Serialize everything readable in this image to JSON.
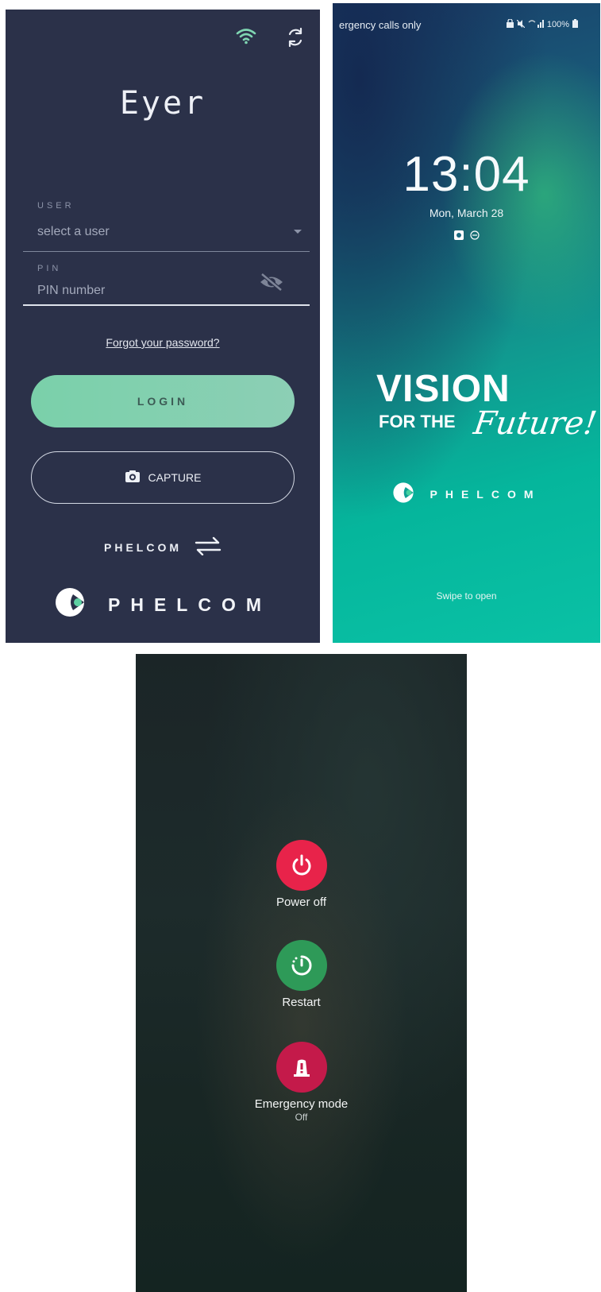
{
  "login": {
    "title": "Eyer",
    "user_label": "USER",
    "user_placeholder": "select a user",
    "pin_label": "PIN",
    "pin_placeholder": "PIN number",
    "forgot_link": "Forgot your password?",
    "login_button": "LOGIN",
    "capture_button": "CAPTURE",
    "switch_brand": "PHELCOM",
    "brand": "PHELCOM",
    "icons": [
      "wifi-icon",
      "sync-icon",
      "eye-off-icon",
      "camera-icon",
      "swap-icon",
      "phelcom-logo-icon"
    ],
    "colors": {
      "background": "#2b3149",
      "login_button": "#7fd0ae"
    }
  },
  "lockscreen": {
    "status_left": "ergency calls only",
    "status_right": "100%",
    "time": "13:04",
    "date": "Mon, March 28",
    "slogan_line1": "VISION",
    "slogan_line2a": "FOR THE",
    "slogan_line2b": "Future!",
    "brand": "PHELCOM",
    "swipe_hint": "Swipe to open"
  },
  "power_menu": {
    "items": [
      {
        "label": "Power off",
        "color": "#e8234a"
      },
      {
        "label": "Restart",
        "color": "#2e9a58"
      },
      {
        "label": "Emergency mode",
        "sub": "Off",
        "color": "#c41a4a"
      }
    ]
  }
}
